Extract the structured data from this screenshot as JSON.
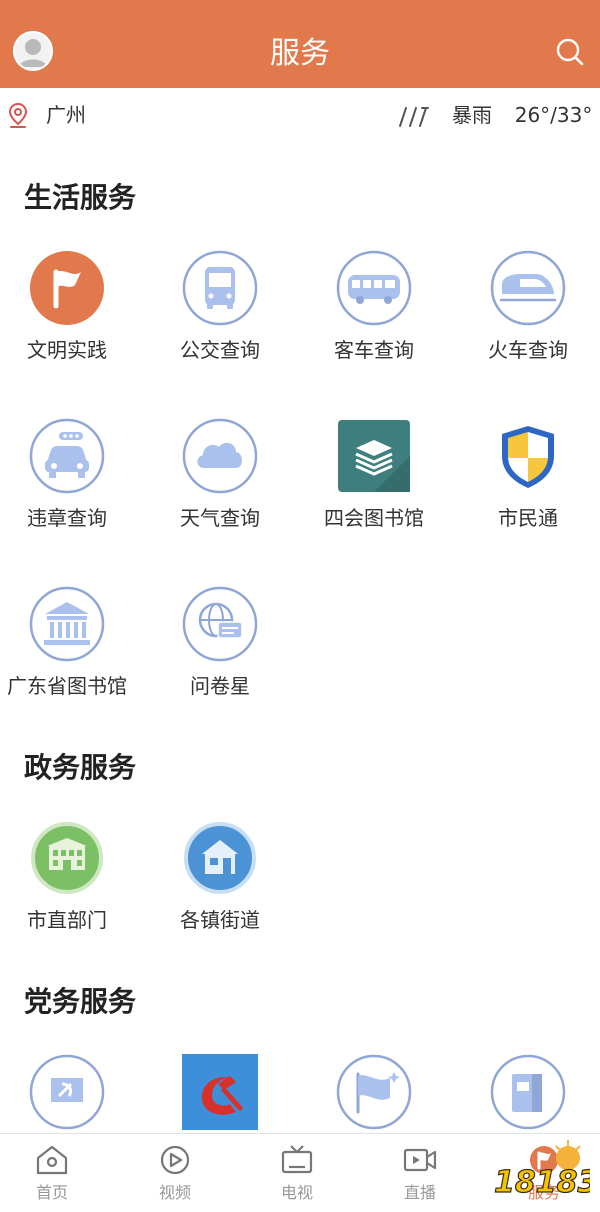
{
  "header": {
    "title": "服务"
  },
  "location": {
    "city": "广州"
  },
  "weather": {
    "condition": "暴雨",
    "temp": "26°/33°"
  },
  "sections": {
    "life": {
      "title": "生活服务",
      "items": [
        "文明实践",
        "公交查询",
        "客车查询",
        "火车查询",
        "违章查询",
        "天气查询",
        "四会图书馆",
        "市民通",
        "广东省图书馆",
        "问卷星"
      ]
    },
    "gov": {
      "title": "政务服务",
      "items": [
        "市直部门",
        "各镇街道"
      ]
    },
    "party": {
      "title": "党务服务"
    }
  },
  "tabbar": [
    "首页",
    "视频",
    "电视",
    "直播",
    "服务"
  ],
  "colors": {
    "brand": "#E2794C",
    "icon_ring": "#8FA6D6",
    "icon_fill": "#A9C1EC"
  },
  "watermark": {
    "text": "18183"
  }
}
